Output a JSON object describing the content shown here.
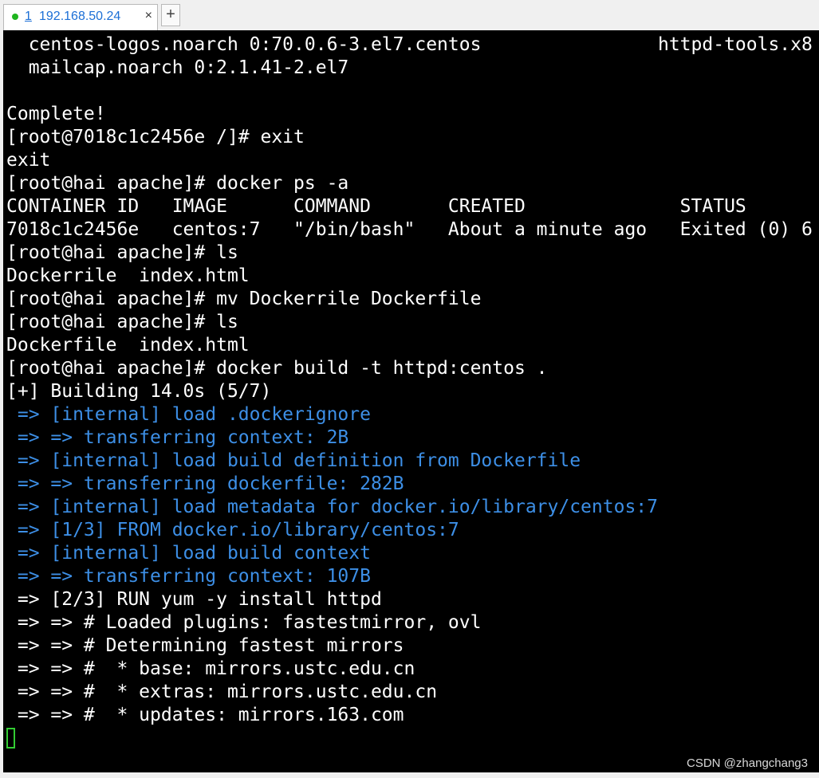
{
  "tab": {
    "index": "1",
    "title": "192.168.50.24",
    "close_glyph": "×"
  },
  "new_tab_glyph": "+",
  "terminal": {
    "lines": [
      {
        "text": "  centos-logos.noarch 0:70.0.6-3.el7.centos                httpd-tools.x8",
        "style": "white"
      },
      {
        "text": "  mailcap.noarch 0:2.1.41-2.el7",
        "style": "white"
      },
      {
        "text": "",
        "style": "white"
      },
      {
        "text": "Complete!",
        "style": "white"
      },
      {
        "text": "[root@7018c1c2456e /]# exit",
        "style": "white"
      },
      {
        "text": "exit",
        "style": "white"
      },
      {
        "text": "[root@hai apache]# docker ps -a",
        "style": "white"
      },
      {
        "text": "CONTAINER ID   IMAGE      COMMAND       CREATED              STATUS",
        "style": "white"
      },
      {
        "text": "7018c1c2456e   centos:7   \"/bin/bash\"   About a minute ago   Exited (0) 6",
        "style": "white"
      },
      {
        "text": "[root@hai apache]# ls",
        "style": "white"
      },
      {
        "text": "Dockerrile  index.html",
        "style": "white"
      },
      {
        "text": "[root@hai apache]# mv Dockerrile Dockerfile",
        "style": "white"
      },
      {
        "text": "[root@hai apache]# ls",
        "style": "white"
      },
      {
        "text": "Dockerfile  index.html",
        "style": "white"
      },
      {
        "text": "[root@hai apache]# docker build -t httpd:centos .",
        "style": "white"
      },
      {
        "text": "[+] Building 14.0s (5/7)",
        "style": "white"
      },
      {
        "text": " => [internal] load .dockerignore",
        "style": "blue"
      },
      {
        "text": " => => transferring context: 2B",
        "style": "blue"
      },
      {
        "text": " => [internal] load build definition from Dockerfile",
        "style": "blue"
      },
      {
        "text": " => => transferring dockerfile: 282B",
        "style": "blue"
      },
      {
        "text": " => [internal] load metadata for docker.io/library/centos:7",
        "style": "blue"
      },
      {
        "text": " => [1/3] FROM docker.io/library/centos:7",
        "style": "blue"
      },
      {
        "text": " => [internal] load build context",
        "style": "blue"
      },
      {
        "text": " => => transferring context: 107B",
        "style": "blue"
      },
      {
        "text": " => [2/3] RUN yum -y install httpd",
        "style": "white"
      },
      {
        "text": " => => # Loaded plugins: fastestmirror, ovl",
        "style": "white"
      },
      {
        "text": " => => # Determining fastest mirrors",
        "style": "white"
      },
      {
        "text": " => => #  * base: mirrors.ustc.edu.cn",
        "style": "white"
      },
      {
        "text": " => => #  * extras: mirrors.ustc.edu.cn",
        "style": "white"
      },
      {
        "text": " => => #  * updates: mirrors.163.com",
        "style": "white"
      }
    ]
  },
  "watermark": "CSDN @zhangchang3",
  "colors": {
    "terminal_bg": "#000000",
    "text_white": "#ffffff",
    "text_blue": "#3d8fe6",
    "cursor_green": "#33cc33",
    "tab_title": "#1c6fd6",
    "status_dot": "#1fb51f"
  }
}
